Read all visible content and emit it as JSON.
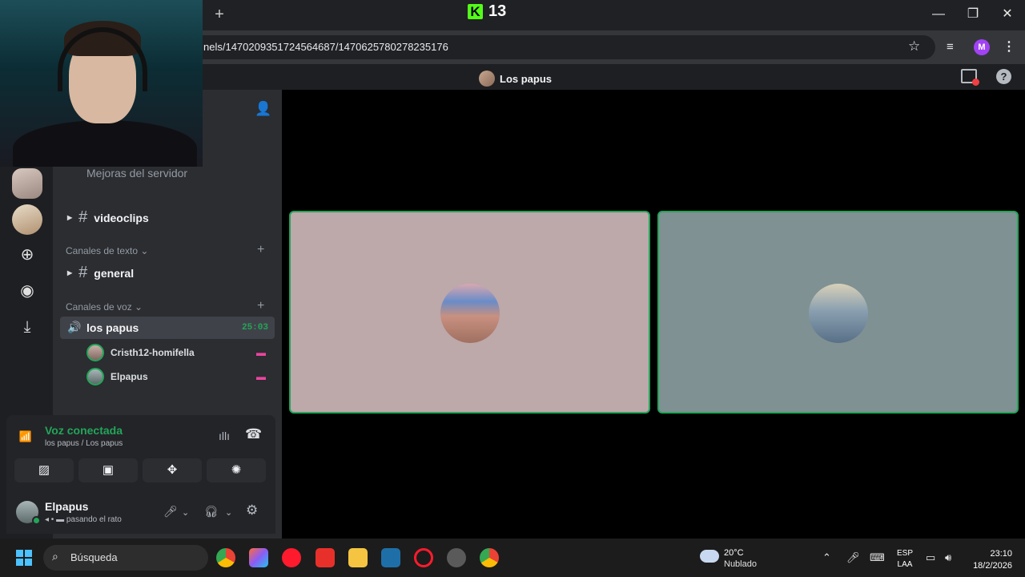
{
  "browser": {
    "new_tab": "+",
    "kick_badge": "K",
    "kick_viewers": "13",
    "url": "nels/1470209351724564687/1470625780278235176",
    "profile_initial": "M",
    "win_min": "—",
    "win_max": "❐",
    "win_close": "✕"
  },
  "call": {
    "title": "Los papus"
  },
  "sidebar": {
    "boost_label": "Mejoras del servidor",
    "channel_videoclips": "videoclips",
    "cat_text": "Canales de texto",
    "channel_general": "general",
    "cat_voice": "Canales de voz",
    "voice_channel": "los papus",
    "voice_time": "25:03",
    "members": [
      {
        "name": "Cristh12-homifella"
      },
      {
        "name": "Elpapus"
      }
    ]
  },
  "voice_panel": {
    "status": "Voz conectada",
    "location": "los papus / Los papus"
  },
  "user": {
    "name": "Elpapus",
    "status": "pasando el rato"
  },
  "taskbar": {
    "search_placeholder": "Búsqueda",
    "weather_temp": "20°C",
    "weather_desc": "Nublado",
    "lang_top": "ESP",
    "lang_bottom": "LAA",
    "time": "23:10",
    "date": "18/2/2026"
  },
  "colors": {
    "discord_green": "#23a559",
    "tile_1_bg": "#bda8aa",
    "tile_2_bg": "#7f9193"
  }
}
